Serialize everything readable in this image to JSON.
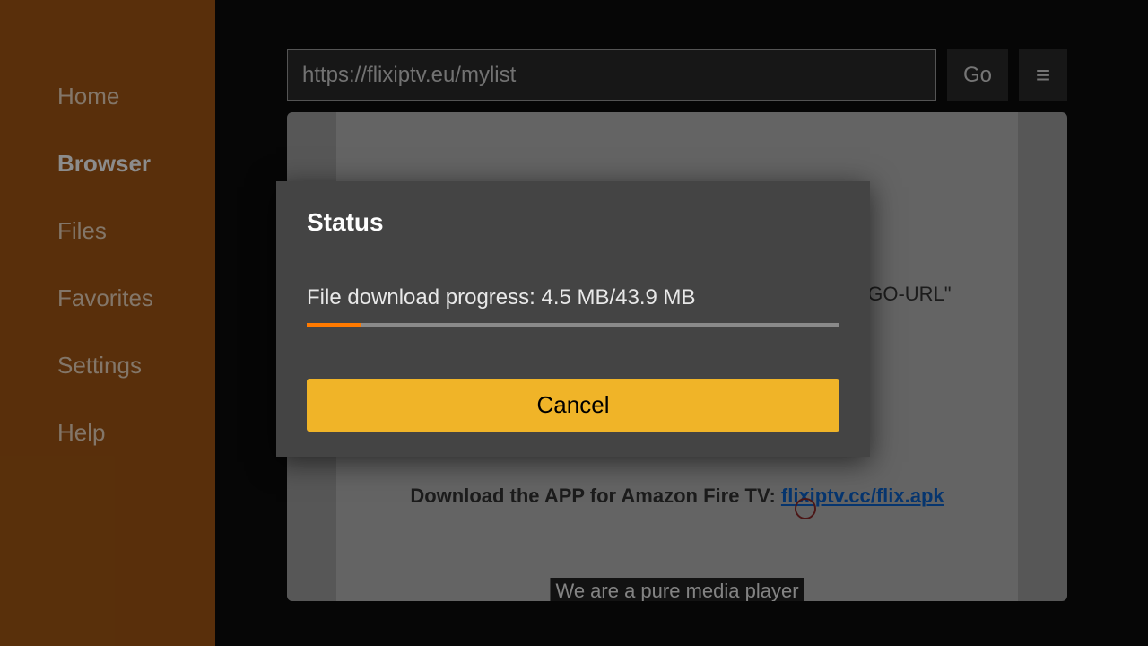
{
  "sidebar": {
    "items": [
      {
        "label": "Home",
        "active": false
      },
      {
        "label": "Browser",
        "active": true
      },
      {
        "label": "Files",
        "active": false
      },
      {
        "label": "Favorites",
        "active": false
      },
      {
        "label": "Settings",
        "active": false
      },
      {
        "label": "Help",
        "active": false
      }
    ]
  },
  "toolbar": {
    "url": "https://flixiptv.eu/mylist",
    "go_label": "Go",
    "menu_glyph": "≡"
  },
  "page": {
    "logo_fragment": "o=\"LOGO-URL\"",
    "download_prefix": "Download the APP for Amazon Fire TV: ",
    "download_link_text": "flixiptv.cc/flix.apk",
    "tagline": "We are a pure media player"
  },
  "dialog": {
    "title": "Status",
    "body_prefix": "File download progress: ",
    "downloaded": "4.5 MB",
    "separator": "/",
    "total": "43.9 MB",
    "progress_percent": 10.25,
    "cancel_label": "Cancel"
  }
}
